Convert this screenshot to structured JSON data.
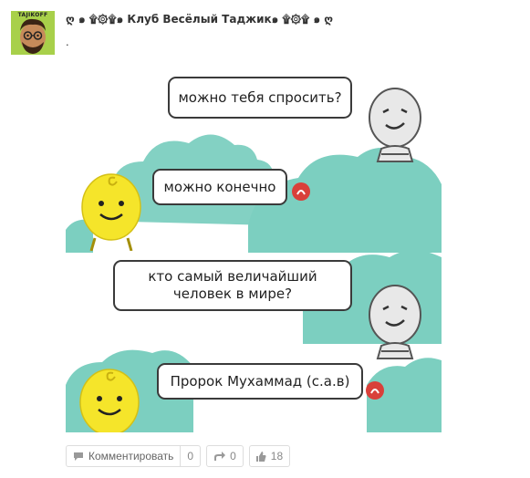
{
  "header": {
    "group_title": "ღ ๑ ۩۞۩๑ Клуб Весёлый Таджик๑ ۩۞۩ ๑ ღ",
    "avatar_label": "TAJIKOFF",
    "post_text": "."
  },
  "comic": {
    "bubble1": "можно тебя спросить?",
    "bubble2": "можно конечно",
    "bubble3_line1": "кто самый величайший",
    "bubble3_line2": "человек в мире?",
    "bubble4": "Пророк Мухаммад (с.а.в)"
  },
  "footer": {
    "comment_label": "Комментировать",
    "comment_count": "0",
    "share_count": "0",
    "like_count": "18"
  },
  "colors": {
    "cloud": "#7ccfc0",
    "yellow_char": "#f5e52a",
    "grey_char": "#e8e8e8",
    "badge": "#d9403a"
  }
}
